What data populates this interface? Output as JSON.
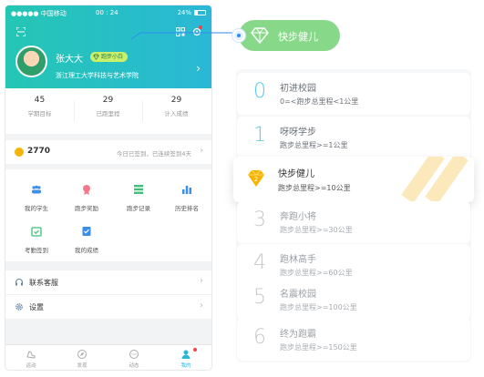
{
  "status": {
    "carrier": "●●●●● 中国移动",
    "time": "00 : 24",
    "battery": "24%"
  },
  "profile": {
    "name": "张大大",
    "badge": "跑步小白",
    "school": "浙江理工大学科技与艺术学院"
  },
  "stats": [
    {
      "value": "45",
      "label": "学期目标"
    },
    {
      "value": "29",
      "label": "已跑里程"
    },
    {
      "value": "29",
      "label": "计入成绩"
    }
  ],
  "signin": {
    "coins": "2770",
    "text": "今日已签到，已连续签到4天"
  },
  "grid": [
    {
      "label": "我的学生",
      "icon": "students-icon"
    },
    {
      "label": "跑步奖励",
      "icon": "reward-icon"
    },
    {
      "label": "跑步记录",
      "icon": "record-list-icon"
    },
    {
      "label": "历史排名",
      "icon": "ranking-chart-icon"
    },
    {
      "label": "考勤签到",
      "icon": "attendance-calendar-icon"
    },
    {
      "label": "我的成绩",
      "icon": "grades-icon"
    }
  ],
  "menu": [
    {
      "label": "联系客服",
      "icon": "headset-icon"
    },
    {
      "label": "设置",
      "icon": "gear-icon"
    }
  ],
  "tabs": [
    {
      "label": "运动"
    },
    {
      "label": "发现"
    },
    {
      "label": "动态"
    },
    {
      "label": "我的"
    }
  ],
  "callout": {
    "label": "快步健儿",
    "color": "#88d88a"
  },
  "levels": [
    {
      "num": "0",
      "title": "初进校园",
      "req": "0=<跑步总里程<1公里"
    },
    {
      "num": "1",
      "title": "呀呀学步",
      "req": "跑步总里程>=1公里"
    },
    {
      "num": "2",
      "title": "快步健儿",
      "req": "跑步总里程>=10公里"
    },
    {
      "num": "3",
      "title": "奔跑小将",
      "req": "跑步总里程>=30公里"
    },
    {
      "num": "4",
      "title": "跑林高手",
      "req": "跑步总里程>=60公里"
    },
    {
      "num": "5",
      "title": "名震校园",
      "req": "跑步总里程>=100公里"
    },
    {
      "num": "6",
      "title": "终为跑霸",
      "req": "跑步总里程>=150公里"
    }
  ],
  "colors": {
    "accent": "#2ab8d6",
    "teal": "#25c6b4",
    "gold": "#f3b50c",
    "level_cyan": "#58cde0"
  }
}
